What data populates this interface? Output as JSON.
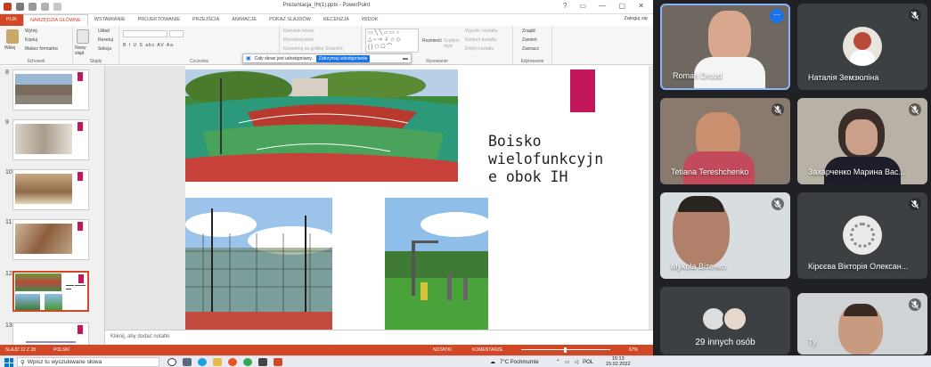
{
  "powerpoint": {
    "window_title": "Prezentacja_IH(1).pptx - PowerPoint",
    "window_controls": "? ▭ — ▢ ✕",
    "tabs": [
      "PLIK",
      "NARZĘDZIA GŁÓWNE",
      "WSTAWIANIE",
      "PROJEKTOWANIE",
      "PRZEJŚCIA",
      "ANIMACJE",
      "POKAZ SLAJDÓW",
      "RECENZJA",
      "WIDOK"
    ],
    "active_tab": "NARZĘDZIA GŁÓWNE",
    "sign_in": "Zaloguj się",
    "ribbon": {
      "clipboard": {
        "paste": "Wklej",
        "cut": "Wytnij",
        "copy": "Kopiuj",
        "format_painter": "Malarz formatów",
        "label": "Schowek"
      },
      "slides": {
        "new_slide": "Nowy slajd",
        "layout": "Układ",
        "reset": "Resetuj",
        "section": "Sekcja",
        "label": "Slajdy"
      },
      "font": {
        "label": "Czcionka",
        "styles": "B  I  U  S  abc  AV  Aa"
      },
      "paragraph": {
        "text_direction": "Kierunek tekstu",
        "align_text": "Wyrównaj tekst",
        "convert_smartart": "Konwertuj na grafikę SmartArt",
        "label": "Akapit"
      },
      "drawing": {
        "arrange": "Rozmieść",
        "quick_styles": "Szybkie style",
        "shape_fill": "Wypełn. kształtu",
        "shape_outline": "Kontury kształtu",
        "shape_effects": "Efekty kształtu",
        "label": "Rysowanie"
      },
      "editing": {
        "find": "Znajdź",
        "replace": "Zamień",
        "select": "Zaznacz",
        "label": "Edytowanie"
      }
    },
    "share_bar": {
      "text": "Cały ekran jest udostępniany.",
      "stop_button": "Zatrzymaj udostępnianie"
    },
    "slide_numbers": [
      "8",
      "9",
      "10",
      "11",
      "12",
      "13"
    ],
    "slide_title": "Boisko\nwielofunkcyjn\ne obok IH",
    "notes_placeholder": "Kliknij, aby dodać notatki",
    "status": {
      "slide": "SLAJD 12 Z 28",
      "language": "POLSKI",
      "notes": "NOTATKI",
      "comments": "KOMENTARZE",
      "zoom": "67%"
    }
  },
  "taskbar": {
    "search_placeholder": "Wpisz tu wyszukiwane słowa",
    "weather": "7°C Pochmurnie",
    "language": "POL",
    "time": "15:13",
    "date": "15.02.2022"
  },
  "meeting": {
    "participants": [
      {
        "name": "Roman Drozd",
        "muted": false,
        "speaking": true
      },
      {
        "name": "Наталія Земзюліна",
        "muted": true
      },
      {
        "name": "Tetiana Tereshchenko",
        "muted": true
      },
      {
        "name": "Захарченко Марина Вас...",
        "muted": true
      },
      {
        "name": "Mykola Вітенко",
        "muted": true
      },
      {
        "name": "Кірєєва Вікторія Олексан...",
        "muted": true
      },
      {
        "name": "Ty",
        "muted": true
      }
    ],
    "others_label": "29 innych osób",
    "more_options": "⋯"
  },
  "colors": {
    "ppt_accent": "#d24726",
    "meet_bg": "#202124",
    "tile_bg": "#3c4043",
    "slide_accent": "#c2185b",
    "share_blue": "#1a73e8"
  }
}
